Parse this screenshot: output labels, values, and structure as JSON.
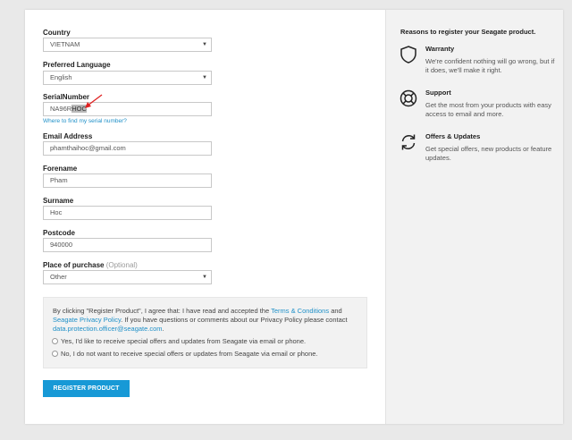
{
  "form": {
    "country": {
      "label": "Country",
      "value": "VIETNAM"
    },
    "language": {
      "label": "Preferred Language",
      "value": "English"
    },
    "serial": {
      "label": "SerialNumber",
      "value_prefix": "NA96R",
      "value_highlight": "HOC",
      "help_link": "Where to find my serial number?"
    },
    "email": {
      "label": "Email Address",
      "value": "phamthaihoc@gmail.com"
    },
    "forename": {
      "label": "Forename",
      "value": "Pham"
    },
    "surname": {
      "label": "Surname",
      "value": "Hoc"
    },
    "postcode": {
      "label": "Postcode",
      "value": "940000"
    },
    "purchase": {
      "label": "Place of purchase",
      "optional": "(Optional)",
      "value": "Other"
    }
  },
  "consent": {
    "text_1": "By clicking \"Register Product\", I agree that: I have read and accepted the ",
    "terms_link": "Terms & Conditions",
    "text_2": " and ",
    "privacy_link": "Seagate Privacy Policy",
    "text_3": ". If you have questions or comments about our Privacy Policy please contact ",
    "email_link": "data.protection.officer@seagate.com",
    "text_4": ".",
    "opt_in": "Yes, I'd like to receive special offers and updates from Seagate via email or phone.",
    "opt_out": "No, I do not want to receive special offers or updates from Seagate via email or phone."
  },
  "actions": {
    "register_label": "REGISTER PRODUCT"
  },
  "sidebar": {
    "title": "Reasons to register your Seagate product.",
    "benefits": [
      {
        "icon": "shield-icon",
        "title": "Warranty",
        "desc": "We're confident nothing will go wrong, but if it does, we'll make it right."
      },
      {
        "icon": "lifebuoy-icon",
        "title": "Support",
        "desc": "Get the most from your products with easy access to email and more."
      },
      {
        "icon": "refresh-icon",
        "title": "Offers & Updates",
        "desc": "Get special offers, new products or feature updates."
      }
    ]
  },
  "colors": {
    "accent": "#1799d6",
    "link": "#1f90c8",
    "annotation_arrow": "#e02020"
  }
}
